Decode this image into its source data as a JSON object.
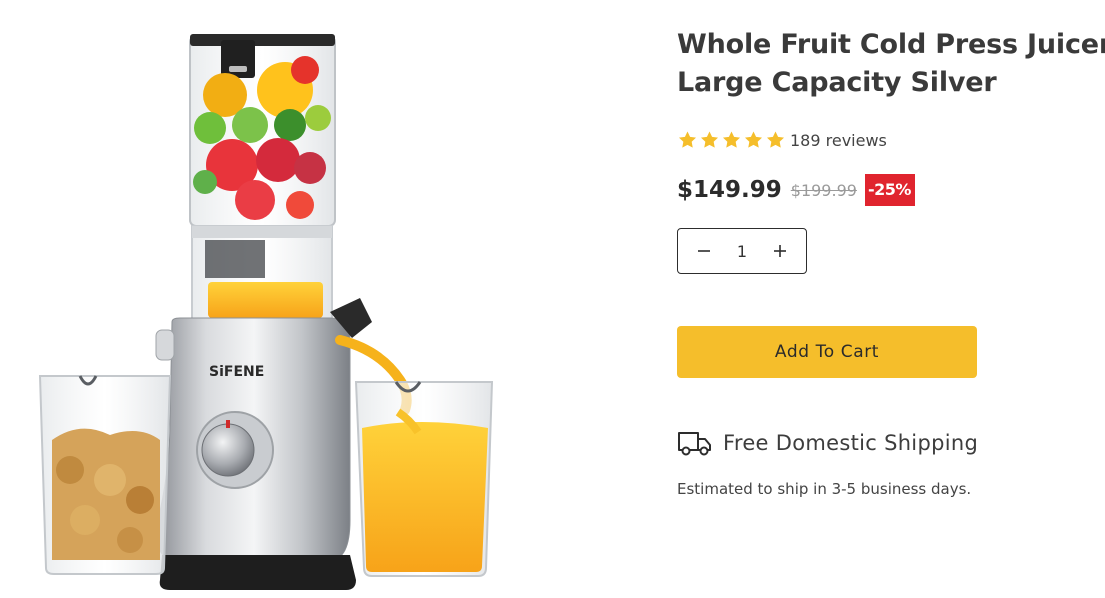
{
  "product": {
    "title_line1": "Whole Fruit Cold Press Juicer",
    "title_line2": "Large Capacity Silver",
    "image_brand": "SiFENE",
    "rating": {
      "stars": 5,
      "max_stars": 5,
      "reviews_label": "189 reviews"
    },
    "price": "$149.99",
    "compare_price": "$199.99",
    "discount_label": "-25%",
    "quantity": "1",
    "add_to_cart_label": "Add To Cart",
    "shipping": {
      "title": "Free Domestic Shipping",
      "note": "Estimated to ship in 3-5 business days."
    }
  },
  "colors": {
    "star": "#f5be2b",
    "button": "#f5be2b",
    "badge": "#e0242e",
    "text": "#3a3a3a"
  },
  "icons": {
    "star": "star-icon",
    "minus": "minus-icon",
    "plus": "plus-icon",
    "truck": "truck-icon"
  }
}
